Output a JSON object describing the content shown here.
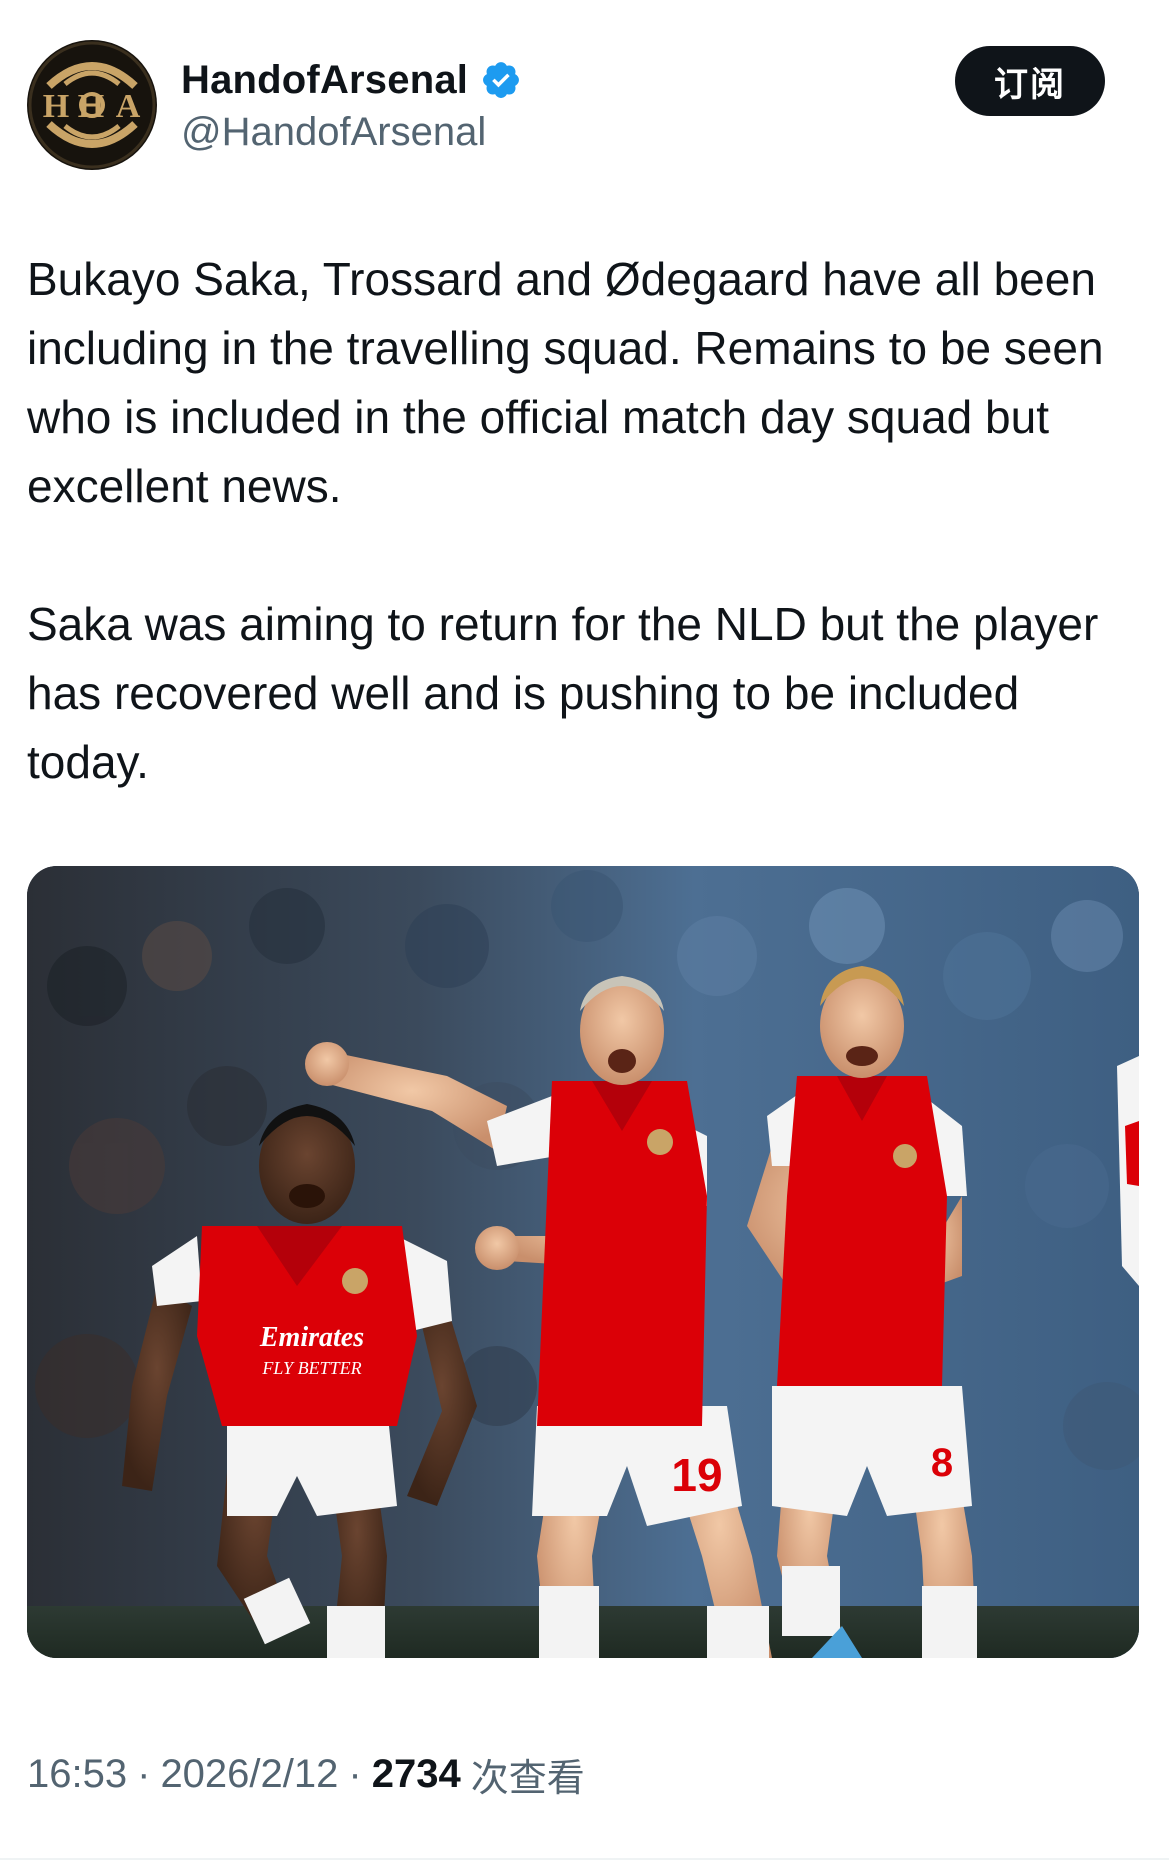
{
  "account": {
    "display_name": "HandofArsenal",
    "handle": "@HandofArsenal",
    "avatar_text": "H⊖A",
    "verified": true
  },
  "actions": {
    "subscribe_label": "订阅"
  },
  "tweet": {
    "paragraphs": [
      "Bukayo Saka, Trossard and Ødegaard have all been including in the travelling squad. Remains to be seen who is included in the official match day squad but excellent news.",
      "Saka was aiming to return for the NLD but the player has recovered well and is pushing to be included today."
    ]
  },
  "media": {
    "shirt_sponsor": "Emirates",
    "shirt_slogan": "FLY BETTER",
    "shirt_numbers": [
      "19",
      "8"
    ]
  },
  "meta": {
    "time": "16:53",
    "separator": "·",
    "date": "2026/2/12",
    "views_count": "2734",
    "views_label": "次查看"
  },
  "colors": {
    "text_primary": "#0f1419",
    "text_secondary": "#536471",
    "verified_blue": "#1d9bf0",
    "button_bg": "#0f1419",
    "arsenal_red": "#db0007",
    "avatar_gold": "#c9a467"
  },
  "icons": {
    "verified": "verified-badge-icon"
  }
}
